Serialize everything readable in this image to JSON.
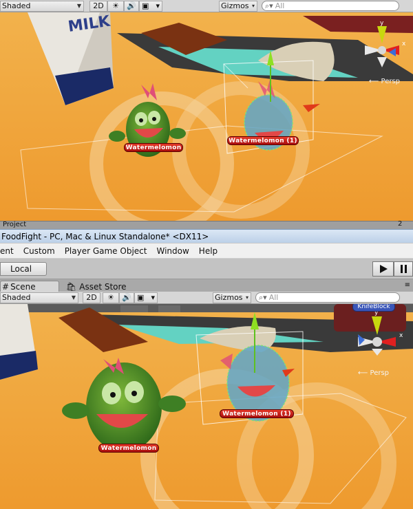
{
  "top_toolbar": {
    "render_mode": "Shaded",
    "mode_2d": "2D",
    "lighting_icon": "sun-icon",
    "audio_icon": "speaker-icon",
    "effects_icon": "image-icon",
    "gizmos": "Gizmos",
    "search_placeholder": "All"
  },
  "top_viewport": {
    "perspective_label": "Persp",
    "carton_text": "MILK",
    "characters": [
      {
        "name": "Watermelomon"
      },
      {
        "name": "Watermelomon (1)"
      }
    ]
  },
  "project_tab": {
    "label": "Project",
    "counter": "2"
  },
  "window": {
    "title": "FoodFight - PC, Mac & Linux Standalone* <DX11>"
  },
  "menu": {
    "items": [
      "ent",
      "Custom",
      "Player Game Object",
      "Window",
      "Help"
    ]
  },
  "main_toolbar": {
    "pivot_label": "Local",
    "play_icon": "play-icon",
    "pause_icon": "pause-icon"
  },
  "tabs": {
    "scene": "Scene",
    "asset_store": "Asset Store"
  },
  "bottom_toolbar": {
    "render_mode": "Shaded",
    "mode_2d": "2D",
    "gizmos": "Gizmos",
    "search_placeholder": "All"
  },
  "bottom_viewport": {
    "perspective_label": "Persp",
    "object_label": "KnifeBlock",
    "characters": [
      {
        "name": "Watermelomon"
      },
      {
        "name": "Watermelomon (1)"
      }
    ]
  },
  "colors": {
    "floor": "#f0a43a",
    "nametag": "#c81e1e",
    "water": "#5fd0c0",
    "title_bar": "#c9daee"
  }
}
